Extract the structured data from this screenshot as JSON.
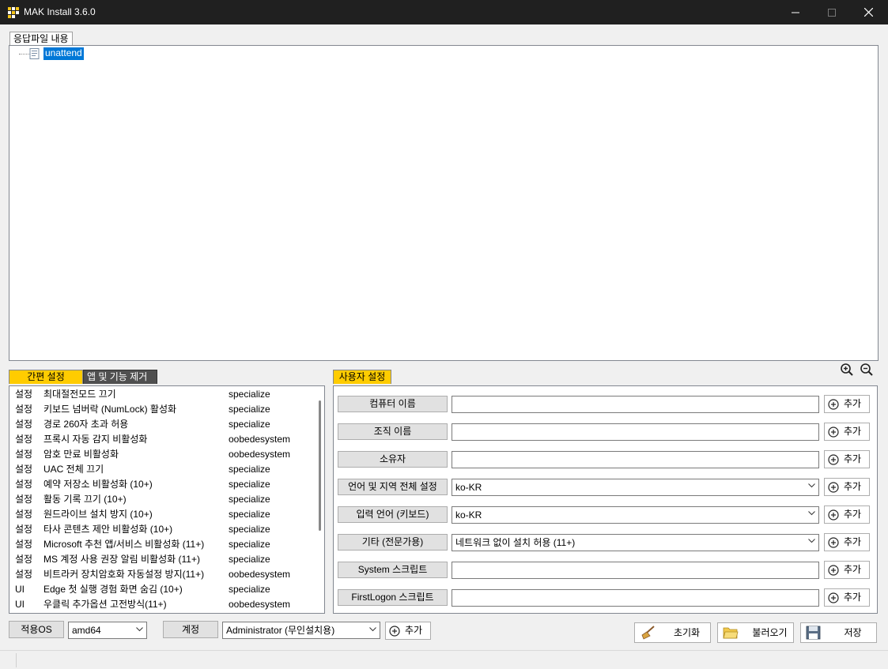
{
  "window": {
    "title": "MAK Install 3.6.0"
  },
  "answer_file": {
    "tab_label": "응답파일 내용",
    "tree_node": "unattend"
  },
  "left_tabs": {
    "quick": "간편 설정",
    "remove": "앱 및 기능 제거"
  },
  "settings_list": [
    {
      "kind": "설정",
      "name": "최대절전모드 끄기",
      "pass": "specialize"
    },
    {
      "kind": "설정",
      "name": "키보드 넘버락 (NumLock) 활성화",
      "pass": "specialize"
    },
    {
      "kind": "설정",
      "name": "경로 260자 초과 허용",
      "pass": "specialize"
    },
    {
      "kind": "설정",
      "name": "프록시 자동 감지 비활성화",
      "pass": "oobedesystem"
    },
    {
      "kind": "설정",
      "name": "암호 만료 비활성화",
      "pass": "oobedesystem"
    },
    {
      "kind": "설정",
      "name": "UAC 전체 끄기",
      "pass": "specialize"
    },
    {
      "kind": "설정",
      "name": "예약 저장소 비활성화 (10+)",
      "pass": "specialize"
    },
    {
      "kind": "설정",
      "name": "활동 기록 끄기 (10+)",
      "pass": "specialize"
    },
    {
      "kind": "설정",
      "name": "원드라이브 설치 방지 (10+)",
      "pass": "specialize"
    },
    {
      "kind": "설정",
      "name": "타사 콘텐츠 제안 비활성화 (10+)",
      "pass": "specialize"
    },
    {
      "kind": "설정",
      "name": "Microsoft 추천 앱/서비스 비활성화 (11+)",
      "pass": "specialize"
    },
    {
      "kind": "설정",
      "name": "MS 계정 사용 권장 알림 비활성화 (11+)",
      "pass": "specialize"
    },
    {
      "kind": "설정",
      "name": "비트라커 장치암호화 자동설정 방지(11+)",
      "pass": "oobedesystem"
    },
    {
      "kind": "UI",
      "name": "Edge 첫 실행 경험 화면 숨김 (10+)",
      "pass": "specialize"
    },
    {
      "kind": "UI",
      "name": "우클릭 추가옵션 고전방식(11+)",
      "pass": "oobedesystem"
    }
  ],
  "user_settings": {
    "tab_label": "사용자 설정",
    "add_label": "추가",
    "rows": [
      {
        "label": "컴퓨터 이름",
        "value": "",
        "dropdown": false
      },
      {
        "label": "조직 이름",
        "value": "",
        "dropdown": false
      },
      {
        "label": "소유자",
        "value": "",
        "dropdown": false
      },
      {
        "label": "언어 및 지역 전체 설정",
        "value": "ko-KR",
        "dropdown": true
      },
      {
        "label": "입력 언어 (키보드)",
        "value": "ko-KR",
        "dropdown": true
      },
      {
        "label": "기타 (전문가용)",
        "value": "네트워크 없이 설치 허용 (11+)",
        "dropdown": true
      },
      {
        "label": "System 스크립트",
        "value": "",
        "dropdown": false
      },
      {
        "label": "FirstLogon 스크립트",
        "value": "",
        "dropdown": false
      }
    ]
  },
  "bottom": {
    "os_label": "적용OS",
    "os_value": "amd64",
    "account_label": "계정",
    "account_value": "Administrator (무인설치용)",
    "account_add": "추가",
    "reset": "초기화",
    "load": "불러오기",
    "save": "저장"
  },
  "colors": {
    "accent_tab": "#ffcc00",
    "selection": "#0078d7",
    "titlebar": "#202020"
  }
}
